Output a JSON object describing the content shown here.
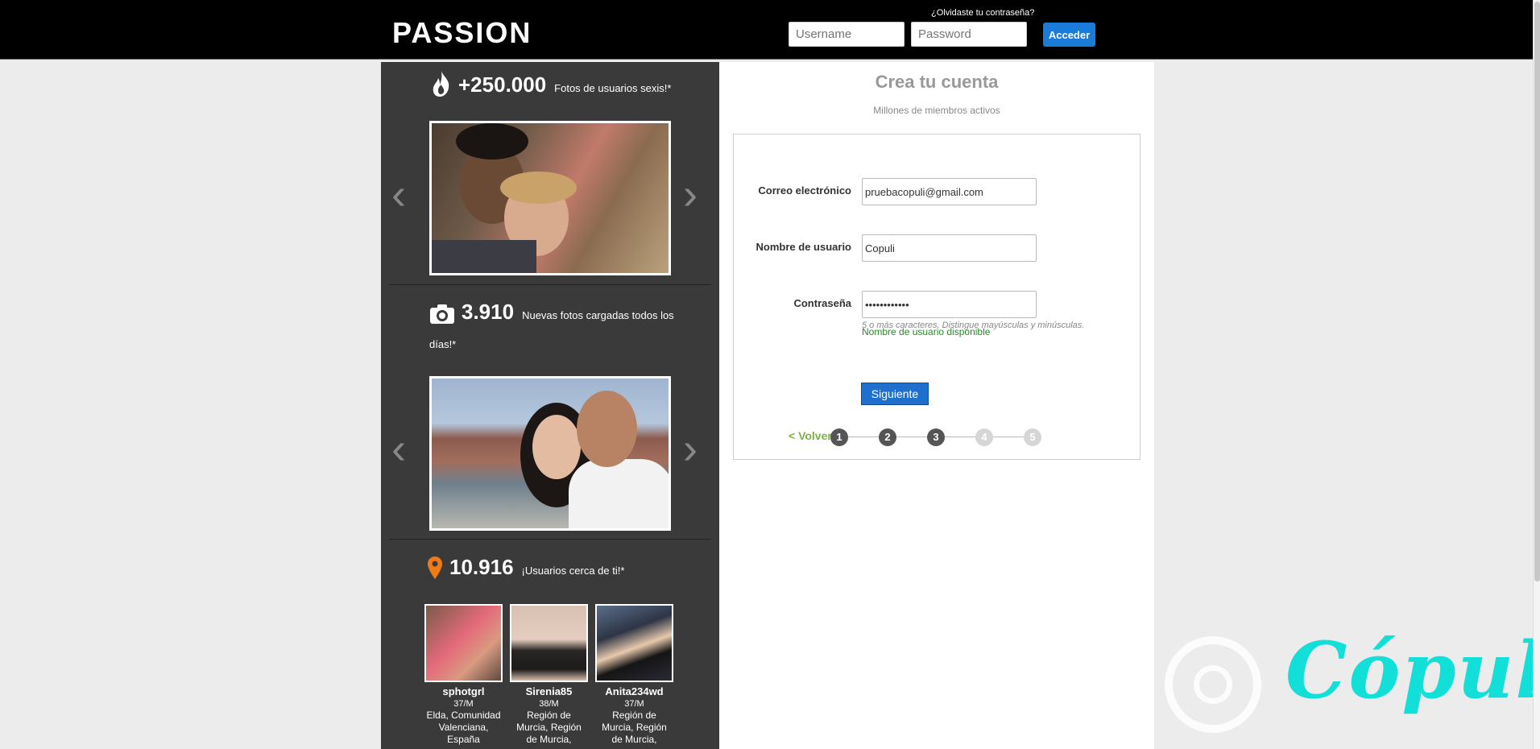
{
  "header": {
    "logo": "PASSION",
    "forgot_password": "¿Olvidaste tu contraseña?",
    "username_placeholder": "Username",
    "password_placeholder": "Password",
    "login_button": "Acceder"
  },
  "left_panel": {
    "stats": [
      {
        "icon": "flame-icon",
        "number": "+250.000",
        "description": "Fotos de usuarios sexis!*"
      },
      {
        "icon": "camera-icon",
        "number": "3.910",
        "description": "Nuevas fotos cargadas todos los",
        "description_cont": "días!*"
      },
      {
        "icon": "map-pin-icon",
        "number": "10.916",
        "description": "¡Usuarios cerca de ti!*"
      }
    ],
    "users": [
      {
        "name": "sphotgrl",
        "age": "37/M",
        "location": "Elda, Comunidad Valenciana, España"
      },
      {
        "name": "Sirenia85",
        "age": "38/M",
        "location": "Región de Murcia, Región de Murcia,"
      },
      {
        "name": "Anita234wd",
        "age": "37/M",
        "location": "Región de Murcia, Región de Murcia,"
      }
    ]
  },
  "form": {
    "title": "Crea tu cuenta",
    "subtitle": "Millones de miembros activos",
    "email_label": "Correo electrónico",
    "email_value": "pruebacopuli@gmail.com",
    "username_label": "Nombre de usuario",
    "username_value": "Copuli",
    "username_status": "Nombre de usuario disponible",
    "password_label": "Contraseña",
    "password_value": "••••••••••••",
    "password_hint": "5 o más caracteres. Distingue mayúsculas y minúsculas.",
    "next_button": "Siguiente",
    "back_link": "< Volver",
    "steps": [
      "1",
      "2",
      "3",
      "4",
      "5"
    ],
    "current_step": 3
  },
  "watermark": {
    "text": "Cópuli"
  },
  "colors": {
    "accent_blue": "#1a7bd8",
    "success_green": "#2a8a2a",
    "back_green": "#7cb342",
    "watermark_cyan": "#12e0d8"
  }
}
